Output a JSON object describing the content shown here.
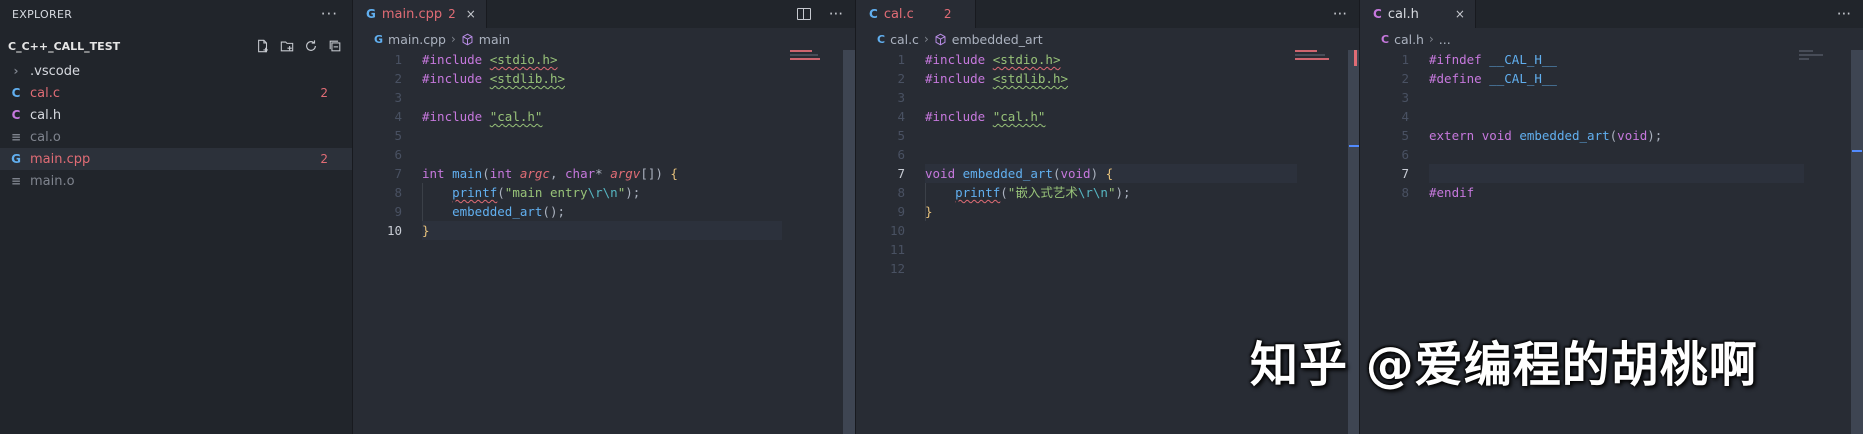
{
  "explorer": {
    "title": "EXPLORER",
    "more": "···",
    "folder": "C_C++_CALL_TEST",
    "files": [
      {
        "name": ".vscode",
        "icon": "chevron-right-icon",
        "badge": "",
        "state": "plain"
      },
      {
        "name": "cal.c",
        "icon": "c-file-icon",
        "badge": "2",
        "state": "modified"
      },
      {
        "name": "cal.h",
        "icon": "c-header-icon",
        "badge": "",
        "state": "plain"
      },
      {
        "name": "cal.o",
        "icon": "object-file-icon",
        "badge": "",
        "state": "dim"
      },
      {
        "name": "main.cpp",
        "icon": "cpp-file-icon",
        "badge": "2",
        "state": "modified"
      },
      {
        "name": "main.o",
        "icon": "object-file-icon",
        "badge": "",
        "state": "dim"
      }
    ]
  },
  "editor1": {
    "tab": {
      "label": "main.cpp",
      "count": "2",
      "close": "×"
    },
    "breadcrumb": {
      "file": "main.cpp",
      "symbol": "main"
    },
    "more": "···"
  },
  "editor2": {
    "tab": {
      "label": "cal.c",
      "count": "2"
    },
    "breadcrumb": {
      "file": "cal.c",
      "symbol": "embedded_art"
    },
    "more": "···"
  },
  "editor3": {
    "tab": {
      "label": "cal.h",
      "close": "×"
    },
    "breadcrumb": {
      "file": "cal.h",
      "symbol": "..."
    },
    "more": "···"
  },
  "code1": {
    "line_numbers": [
      "1",
      "2",
      "3",
      "4",
      "5",
      "6",
      "7",
      "8",
      "9",
      "10"
    ],
    "active_line": "10",
    "inc1_kw": "#include",
    "inc1_file": "<stdio.h>",
    "inc2_kw": "#include",
    "inc2_file": "<stdlib.h>",
    "inc3_kw": "#include",
    "inc3_file": "\"cal.h\"",
    "l7_int": "int",
    "l7_main": "main",
    "l7_int2": "int",
    "l7_argc": "argc",
    "l7_char": "char",
    "l7_argv": "argv",
    "l8_printf": "printf",
    "l8_str1": "\"main entry",
    "l8_esc": "\\r\\n",
    "l8_str2": "\"",
    "l9_call": "embedded_art",
    "l10_brace": "}"
  },
  "code2": {
    "line_numbers": [
      "1",
      "2",
      "3",
      "4",
      "5",
      "6",
      "7",
      "8",
      "9",
      "10",
      "11",
      "12"
    ],
    "active_line": "7",
    "inc1_kw": "#include",
    "inc1_file": "<stdio.h>",
    "inc2_kw": "#include",
    "inc2_file": "<stdlib.h>",
    "inc3_kw": "#include",
    "inc3_file": "\"cal.h\"",
    "l7_void": "void",
    "l7_fn": "embedded_art",
    "l7_void2": "void",
    "l8_printf": "printf",
    "l8_str1": "\"嵌入式艺术",
    "l8_esc": "\\r\\n",
    "l8_str2": "\"",
    "l9_brace": "}"
  },
  "code3": {
    "line_numbers": [
      "1",
      "2",
      "3",
      "4",
      "5",
      "6",
      "7",
      "8"
    ],
    "active_line": "7",
    "l1_kw": "#ifndef",
    "l1_id": "__CAL_H__",
    "l2_kw": "#define",
    "l2_id": "__CAL_H__",
    "l5_extern": "extern",
    "l5_void": "void",
    "l5_fn": "embedded_art",
    "l5_void2": "void",
    "l8_kw": "#endif"
  },
  "watermark": "知乎 @爱编程的胡桃啊",
  "colors": {
    "accent": "#528bff",
    "error": "#e06c75",
    "bg": "#282c34",
    "sidebar": "#21252b"
  }
}
